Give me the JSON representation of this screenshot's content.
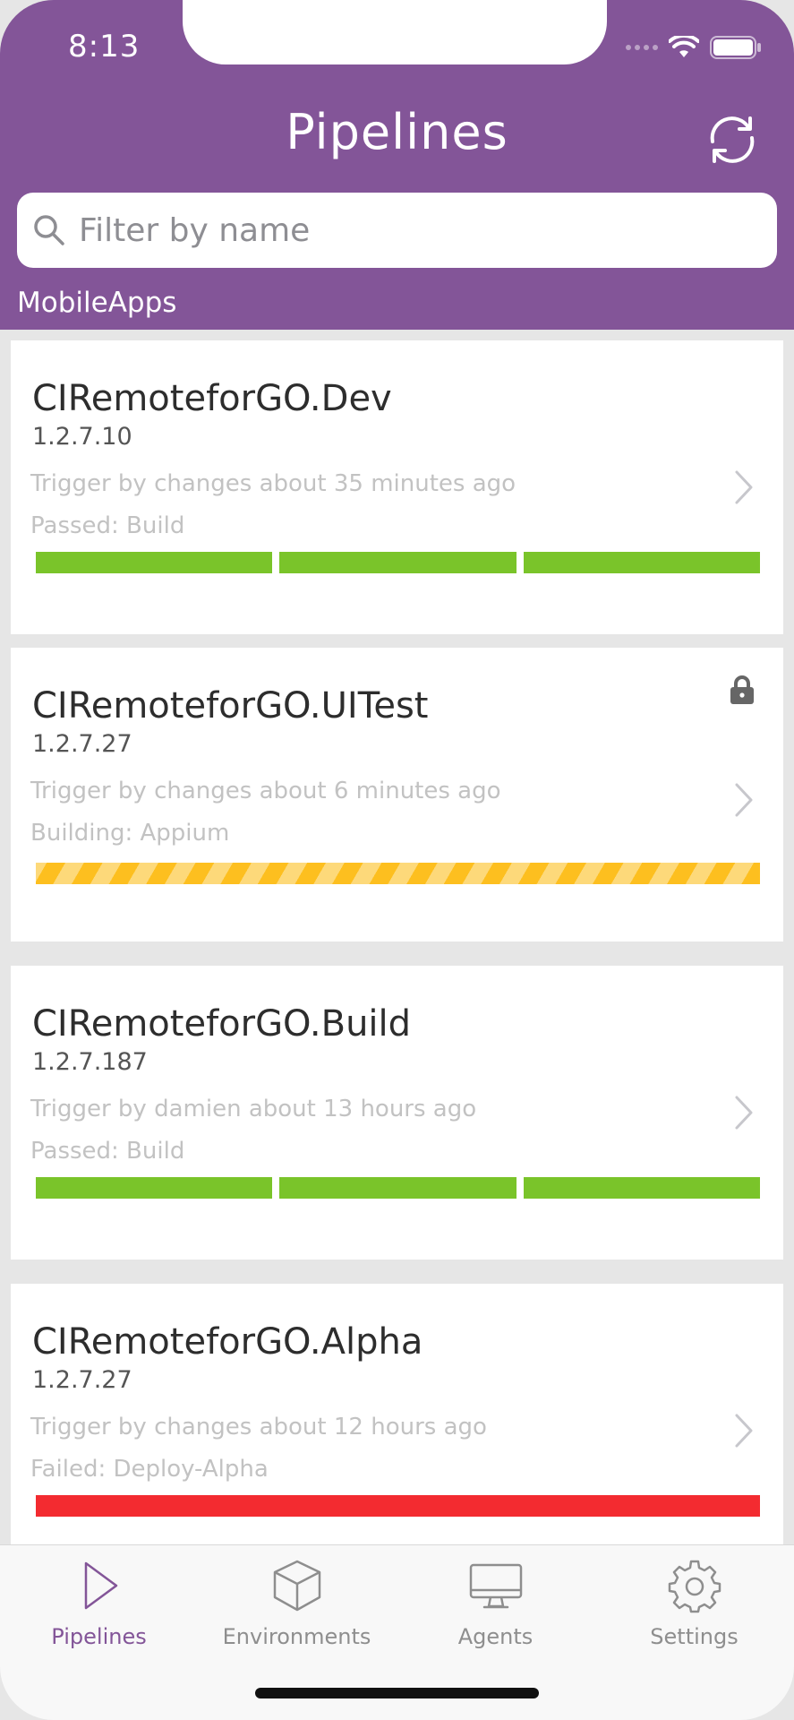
{
  "status_bar": {
    "time": "8:13"
  },
  "header": {
    "title": "Pipelines",
    "refresh_icon": "refresh-icon",
    "search": {
      "placeholder": "Filter by name",
      "value": ""
    },
    "group": "MobileApps",
    "colors": {
      "brand": "#835598"
    }
  },
  "pipelines": [
    {
      "name": "CIRemoteforGO.Dev",
      "version": "1.2.7.10",
      "trigger": "Trigger by changes about 35 minutes ago",
      "status": "Passed: Build",
      "locked": false,
      "stages": [
        "passed",
        "passed",
        "passed"
      ]
    },
    {
      "name": "CIRemoteforGO.UITest",
      "version": "1.2.7.27",
      "trigger": "Trigger by changes about 6 minutes ago",
      "status": "Building: Appium",
      "locked": true,
      "stages": [
        "building"
      ]
    },
    {
      "name": "CIRemoteforGO.Build",
      "version": "1.2.7.187",
      "trigger": "Trigger by damien about 13 hours ago",
      "status": "Passed: Build",
      "locked": false,
      "stages": [
        "passed",
        "passed",
        "passed"
      ]
    },
    {
      "name": "CIRemoteforGO.Alpha",
      "version": "1.2.7.27",
      "trigger": "Trigger by changes about 12 hours ago",
      "status": "Failed: Deploy-Alpha",
      "locked": false,
      "stages": [
        "failed"
      ]
    }
  ],
  "stage_colors": {
    "passed": "#7ac42a",
    "building": "#fdbf1f",
    "failed": "#f32b30"
  },
  "tabbar": {
    "tabs": [
      {
        "label": "Pipelines",
        "icon": "play-icon",
        "active": true
      },
      {
        "label": "Environments",
        "icon": "cube-icon",
        "active": false
      },
      {
        "label": "Agents",
        "icon": "monitor-icon",
        "active": false
      },
      {
        "label": "Settings",
        "icon": "gear-icon",
        "active": false
      }
    ]
  }
}
